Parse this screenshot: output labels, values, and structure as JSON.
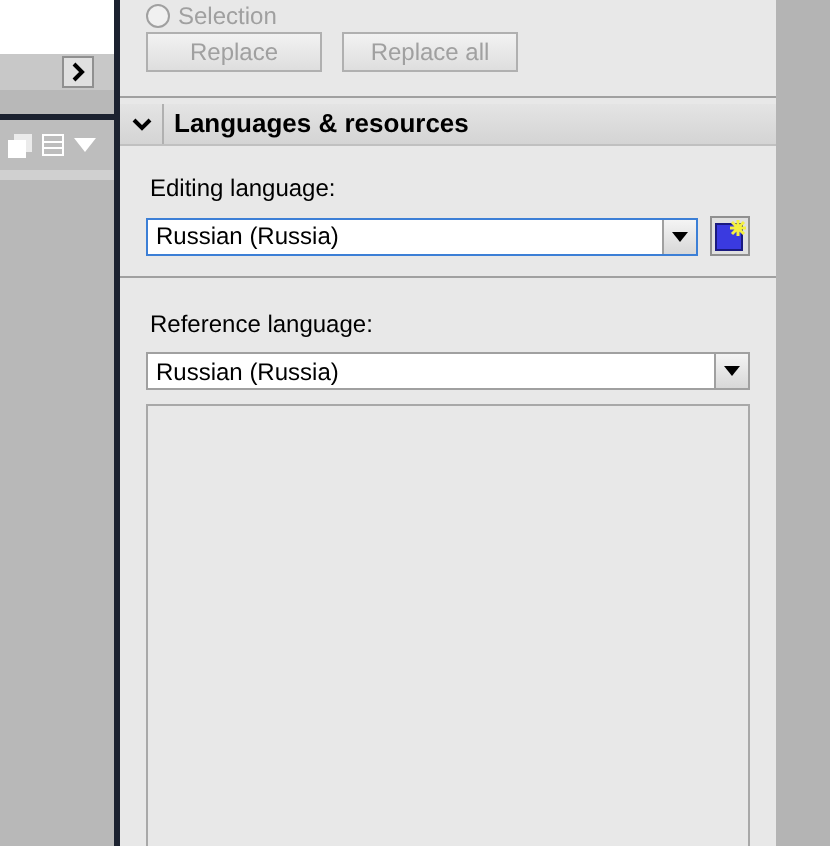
{
  "find_replace": {
    "option": {
      "label": "Selection",
      "selected": false
    },
    "buttons": [
      {
        "label": "Replace",
        "disabled": true
      },
      {
        "label": "Replace all",
        "disabled": true
      }
    ]
  },
  "languages_section": {
    "title": "Languages & resources",
    "expanded": true,
    "editing_language": {
      "label": "Editing language:",
      "value": "Russian (Russia)",
      "focused": true
    },
    "reference_language": {
      "label": "Reference language:",
      "value": "Russian (Russia)",
      "focused": false
    }
  }
}
